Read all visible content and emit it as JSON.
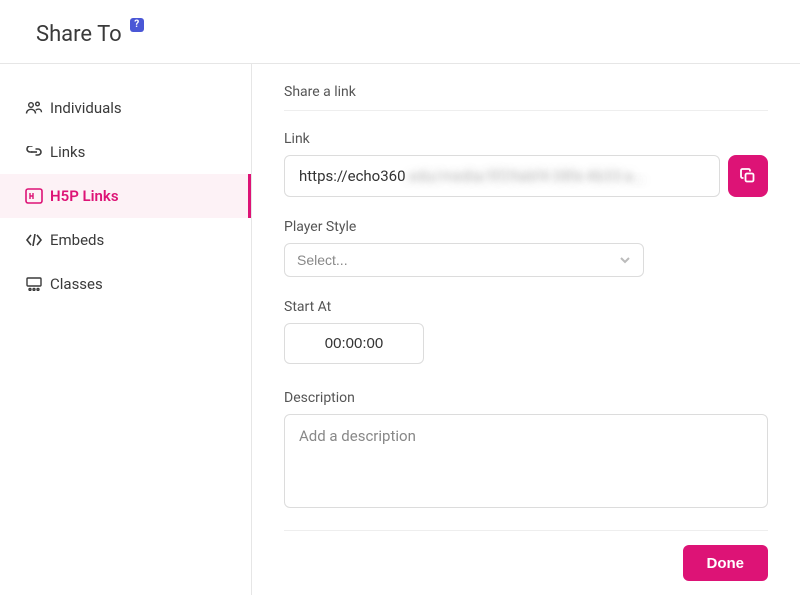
{
  "header": {
    "title": "Share To",
    "help": "?"
  },
  "sidebar": {
    "items": [
      {
        "label": "Individuals",
        "icon": "people-icon",
        "active": false
      },
      {
        "label": "Links",
        "icon": "link-icon",
        "active": false
      },
      {
        "label": "H5P Links",
        "icon": "h5p-icon",
        "active": true
      },
      {
        "label": "Embeds",
        "icon": "code-icon",
        "active": false
      },
      {
        "label": "Classes",
        "icon": "class-icon",
        "active": false
      }
    ]
  },
  "main": {
    "section_title": "Share a link",
    "link_label": "Link",
    "link_prefix": "https://echo360",
    "link_obscured": ".edu/media/5f29abf4-38fe-4b33-a...",
    "player_style_label": "Player Style",
    "player_style_placeholder": "Select...",
    "start_at_label": "Start At",
    "start_at_value": "00:00:00",
    "description_label": "Description",
    "description_placeholder": "Add a description",
    "done_label": "Done"
  },
  "colors": {
    "accent": "#dd1376"
  }
}
